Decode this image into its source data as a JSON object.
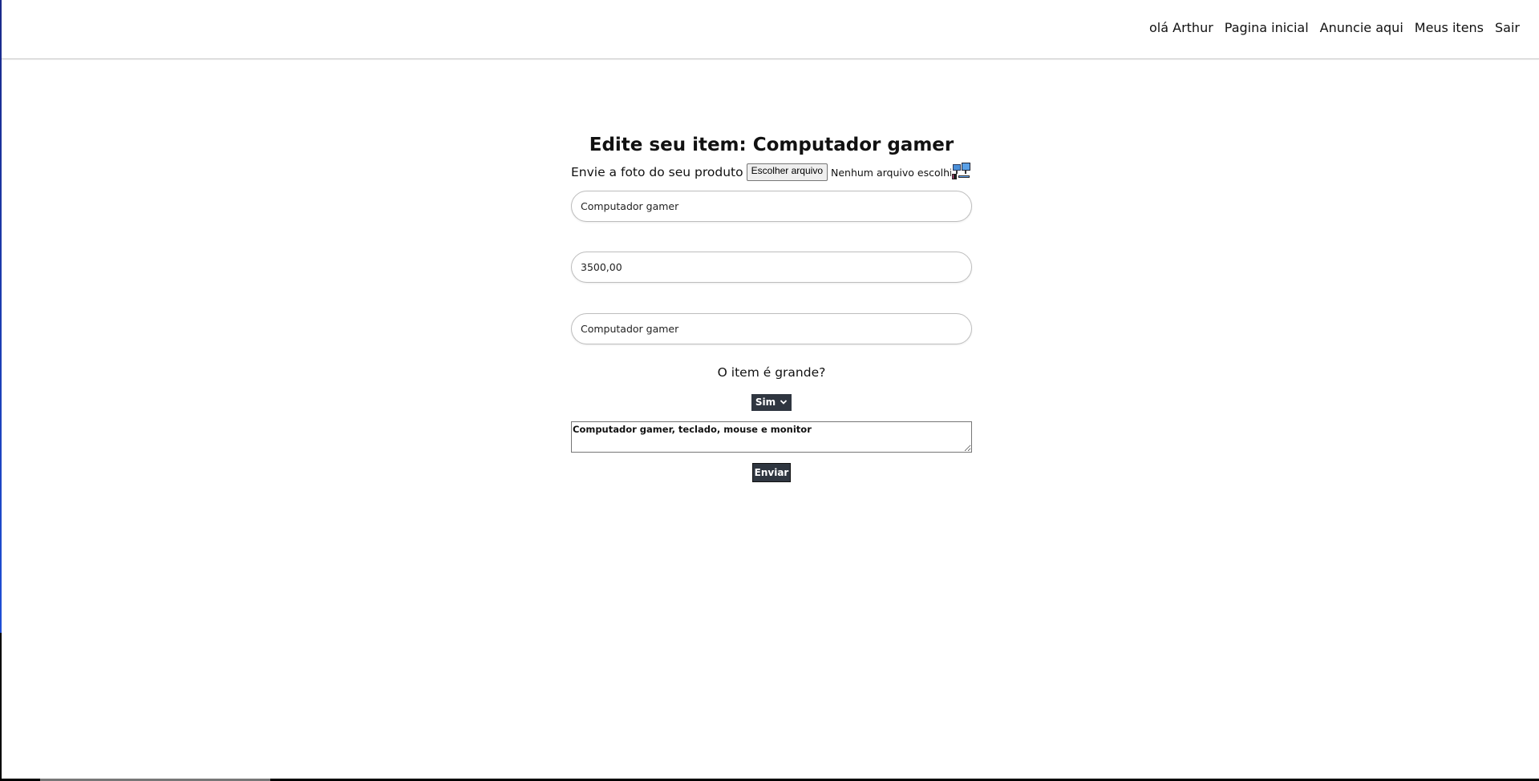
{
  "navbar": {
    "greeting": "olá Arthur",
    "links": [
      {
        "label": "Pagina inicial"
      },
      {
        "label": "Anuncie aqui"
      },
      {
        "label": "Meus itens"
      },
      {
        "label": "Sair"
      }
    ]
  },
  "form": {
    "title": "Edite seu item: Computador gamer",
    "upload_label": "Envie a foto do seu produto",
    "file_button_label": "Escolher arquivo",
    "file_status": "Nenhum arquivo escolhido",
    "name_value": "Computador gamer",
    "price_value": "3500,00",
    "title_value": "Computador gamer",
    "size_question": "O item é grande?",
    "size_selected": "Sim",
    "description_value": "Computador gamer, teclado, mouse e monitor",
    "submit_label": "Enviar"
  },
  "colors": {
    "dark_button": "#2f3640",
    "divider": "#c8c8c8",
    "input_border": "#bdbdbd"
  },
  "icons": {
    "thumbnail": "product-thumbnail-image",
    "select_arrow": "chevron-down-icon"
  }
}
